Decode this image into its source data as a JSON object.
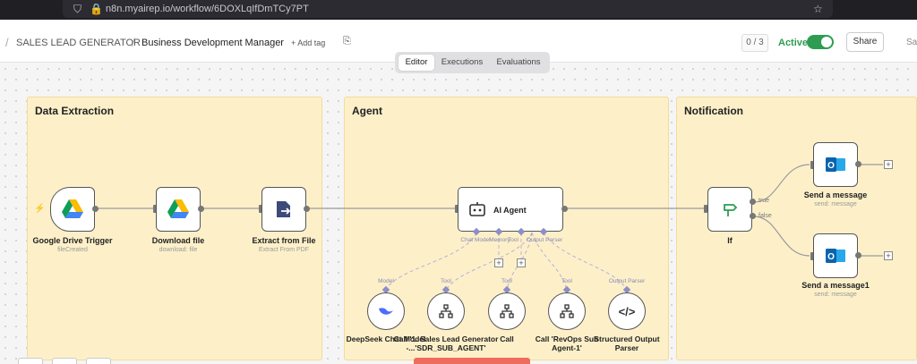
{
  "browser": {
    "url": "n8n.myairep.io/workflow/6DOXLqIfDmTCy7PT"
  },
  "header": {
    "breadcrumb_1": "SALES LEAD GENERATOR",
    "breadcrumb_2": "Business Development Manager",
    "add_tag": "+ Add tag",
    "counter": "0 / 3",
    "active_label": "Active",
    "active": true,
    "share": "Share",
    "save": "Sa"
  },
  "tabs": [
    "Editor",
    "Executions",
    "Evaluations"
  ],
  "sections": {
    "data_extraction": "Data Extraction",
    "agent": "Agent",
    "notification": "Notification"
  },
  "nodes": {
    "trigger": {
      "label": "Google Drive Trigger",
      "sub": "fileCreated"
    },
    "download": {
      "label": "Download file",
      "sub": "download: file"
    },
    "extract": {
      "label": "Extract from File",
      "sub": "Extract From PDF"
    },
    "ai_agent": {
      "label": "AI Agent"
    },
    "if": {
      "label": "If",
      "true": "true",
      "false": "false"
    },
    "send1": {
      "label": "Send a message",
      "sub": "send: message"
    },
    "send2": {
      "label": "Send a message1",
      "sub": "send: message"
    }
  },
  "agent_ports": {
    "chat_model": "Chat Model",
    "memory": "Memory",
    "tool": "Tool",
    "output_parser": "Output Parser"
  },
  "subnodes": [
    {
      "type": "Model",
      "label": "DeepSeek Chat Model"
    },
    {
      "type": "Tool",
      "label": "Call '1. Sales Lead Generator -...'SDR_SUB_AGENT'"
    },
    {
      "type": "Tool",
      "label": "Call"
    },
    {
      "type": "Tool",
      "label": "Call 'RevOps Sub Agent-1'"
    },
    {
      "type": "Output Parser",
      "label": "Structured Output Parser"
    }
  ],
  "colors": {
    "accent_green": "#2e9c52",
    "sticky": "#fdf0c9",
    "port": "#8d8dc7"
  }
}
